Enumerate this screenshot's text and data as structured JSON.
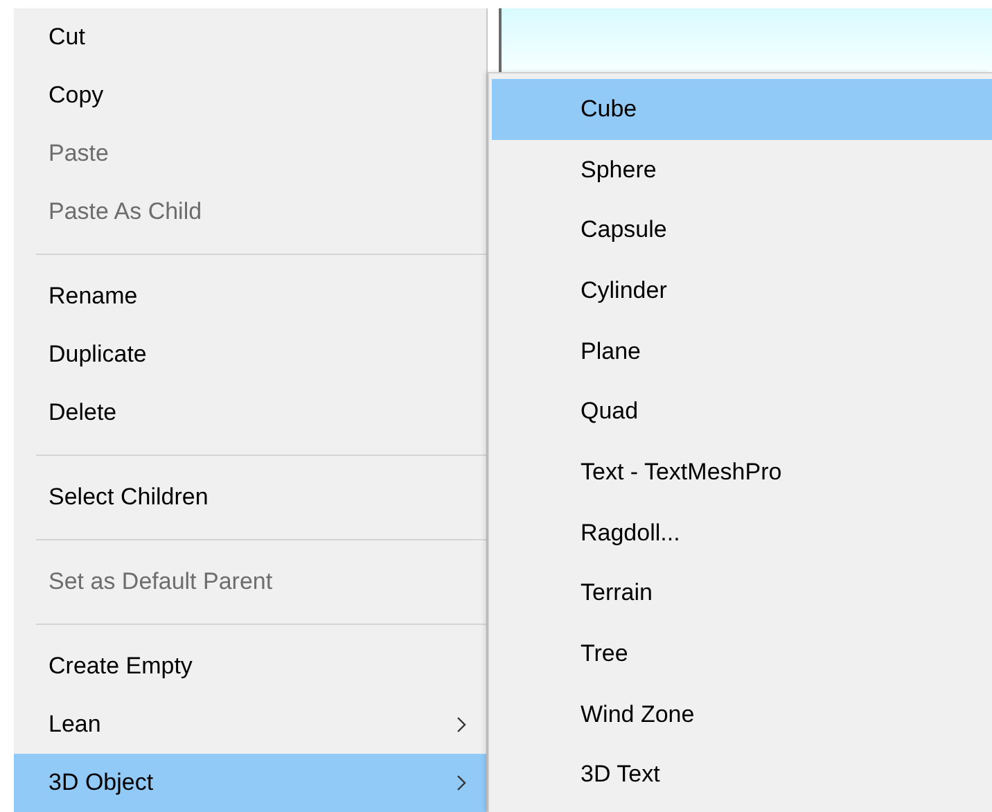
{
  "context_menu": {
    "items": [
      {
        "kind": "item",
        "label": "Cut",
        "disabled": false,
        "selected": false,
        "submenu": false
      },
      {
        "kind": "item",
        "label": "Copy",
        "disabled": false,
        "selected": false,
        "submenu": false
      },
      {
        "kind": "item",
        "label": "Paste",
        "disabled": true,
        "selected": false,
        "submenu": false
      },
      {
        "kind": "item",
        "label": "Paste As Child",
        "disabled": true,
        "selected": false,
        "submenu": false
      },
      {
        "kind": "separator"
      },
      {
        "kind": "item",
        "label": "Rename",
        "disabled": false,
        "selected": false,
        "submenu": false
      },
      {
        "kind": "item",
        "label": "Duplicate",
        "disabled": false,
        "selected": false,
        "submenu": false
      },
      {
        "kind": "item",
        "label": "Delete",
        "disabled": false,
        "selected": false,
        "submenu": false
      },
      {
        "kind": "separator"
      },
      {
        "kind": "item",
        "label": "Select Children",
        "disabled": false,
        "selected": false,
        "submenu": false
      },
      {
        "kind": "separator"
      },
      {
        "kind": "item",
        "label": "Set as Default Parent",
        "disabled": true,
        "selected": false,
        "submenu": false
      },
      {
        "kind": "separator"
      },
      {
        "kind": "item",
        "label": "Create Empty",
        "disabled": false,
        "selected": false,
        "submenu": false
      },
      {
        "kind": "item",
        "label": "Lean",
        "disabled": false,
        "selected": false,
        "submenu": true
      },
      {
        "kind": "item",
        "label": "3D Object",
        "disabled": false,
        "selected": true,
        "submenu": true
      }
    ]
  },
  "submenu": {
    "items": [
      {
        "label": "Cube",
        "selected": true
      },
      {
        "label": "Sphere",
        "selected": false
      },
      {
        "label": "Capsule",
        "selected": false
      },
      {
        "label": "Cylinder",
        "selected": false
      },
      {
        "label": "Plane",
        "selected": false
      },
      {
        "label": "Quad",
        "selected": false
      },
      {
        "label": "Text - TextMeshPro",
        "selected": false
      },
      {
        "label": "Ragdoll...",
        "selected": false
      },
      {
        "label": "Terrain",
        "selected": false
      },
      {
        "label": "Tree",
        "selected": false
      },
      {
        "label": "Wind Zone",
        "selected": false
      },
      {
        "label": "3D Text",
        "selected": false
      }
    ]
  }
}
